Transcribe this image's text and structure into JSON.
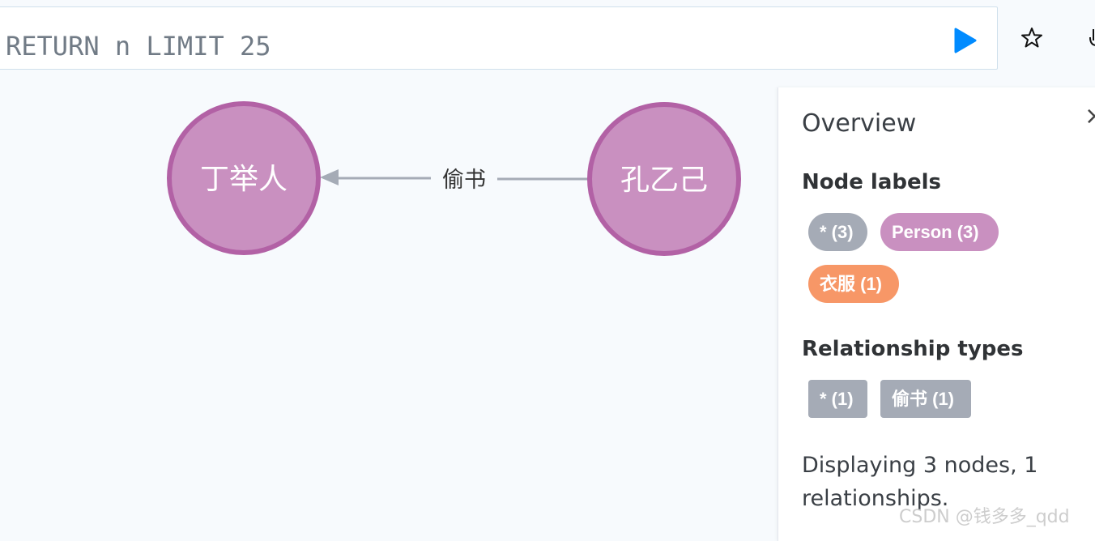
{
  "query": {
    "text": "RETURN n LIMIT 25"
  },
  "graph": {
    "nodes": [
      {
        "label": "丁举人",
        "color": "#c990c0",
        "border": "#b261a5"
      },
      {
        "label": "孔乙己",
        "color": "#c990c0",
        "border": "#b261a5"
      }
    ],
    "relationship": {
      "label": "偷书",
      "color": "#a5abb6",
      "from": "孔乙己",
      "to": "丁举人"
    }
  },
  "overview": {
    "title": "Overview",
    "close_symbol": "×",
    "node_labels_heading": "Node labels",
    "node_labels": [
      {
        "text": "* (3)",
        "color": "#a5abb6"
      },
      {
        "text": "Person (3)",
        "color": "#c990c0"
      },
      {
        "text": "衣服 (1)",
        "color": "#f79767"
      }
    ],
    "relationship_types_heading": "Relationship types",
    "relationship_types": [
      {
        "text": "* (1)",
        "color": "#a5abb6"
      },
      {
        "text": "偷书 (1)",
        "color": "#a5abb6"
      }
    ],
    "summary": "Displaying 3 nodes, 1 relationships."
  },
  "icons": {
    "run": "play-icon",
    "favorite": "star-icon",
    "download": "download-icon"
  },
  "accent_color": "#018bff",
  "watermark": "CSDN @钱多多_qdd"
}
